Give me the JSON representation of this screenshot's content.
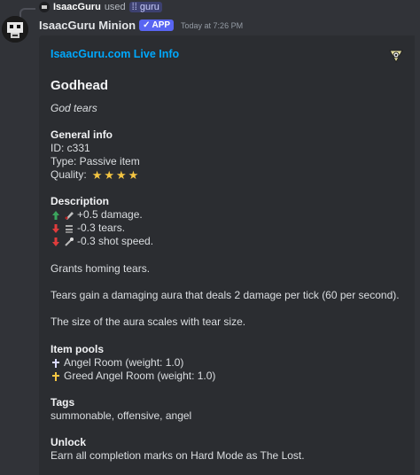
{
  "reply": {
    "user": "IsaacGuru",
    "used_text": "used",
    "command": "guru"
  },
  "message": {
    "author": "IsaacGuru Minion",
    "badge": "APP",
    "timestamp": "Today at 7:26 PM"
  },
  "embed": {
    "author": "IsaacGuru.com Live Info",
    "title": "Godhead",
    "description": "God tears",
    "general": {
      "name": "General info",
      "id": "ID: c331",
      "type": "Type: Passive item",
      "quality_label": "Quality:",
      "quality_stars": 4
    },
    "description_field": {
      "name": "Description",
      "stats": [
        {
          "text": "+0.5 damage.",
          "icon": "up-arrow-icon",
          "stat_icon": "damage-icon"
        },
        {
          "text": "-0.3 tears.",
          "icon": "down-arrow-icon",
          "stat_icon": "tears-icon"
        },
        {
          "text": "-0.3 shot speed.",
          "icon": "down-arrow-icon",
          "stat_icon": "shot-speed-icon"
        }
      ],
      "para1": "Grants homing tears.",
      "para2": "Tears gain a damaging aura that deals 2 damage per tick (60 per second).",
      "para3": "The size of the aura scales with tear size."
    },
    "pools": {
      "name": "Item pools",
      "items": [
        "Angel Room (weight: 1.0)",
        "Greed Angel Room (weight: 1.0)"
      ]
    },
    "tags": {
      "name": "Tags",
      "value": "summonable, offensive, angel"
    },
    "unlock": {
      "name": "Unlock",
      "value": "Earn all completion marks on Hard Mode as The Lost."
    }
  },
  "colors": {
    "link": "#00a8fc",
    "badge": "#5865f2",
    "star": "#f4c542",
    "up_arrow": "#3ba55d",
    "down_arrow": "#e03c3c"
  }
}
